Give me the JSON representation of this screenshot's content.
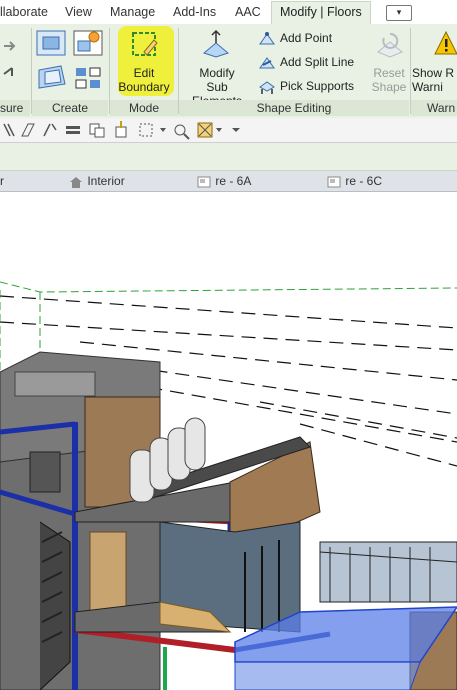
{
  "ribbon_tabs": [
    {
      "label": "llaborate"
    },
    {
      "label": "View"
    },
    {
      "label": "Manage"
    },
    {
      "label": "Add-Ins"
    },
    {
      "label": "AAC"
    },
    {
      "label": "Modify | Floors",
      "active": true
    }
  ],
  "panels": {
    "measure": {
      "title": "sure"
    },
    "create": {
      "title": "Create"
    },
    "mode": {
      "title": "Mode",
      "edit_boundary_label": "Edit\nBoundary"
    },
    "shape_editing": {
      "title": "Shape Editing",
      "modify_sub_elements_label": "Modify\nSub Elements",
      "add_point_label": "Add Point",
      "add_split_line_label": "Add Split Line",
      "pick_supports_label": "Pick Supports",
      "reset_shape_label": "Reset\nShape"
    },
    "warnings": {
      "title": "Warn",
      "show_warnings_label": "Show R\nWarni"
    }
  },
  "view_tabs": [
    {
      "label": "r"
    },
    {
      "label": "Interior",
      "icon": "home-icon"
    },
    {
      "label": "re - 6A",
      "icon": "plan-view-icon"
    },
    {
      "label": "re - 6C",
      "icon": "plan-view-icon"
    }
  ],
  "colors": {
    "ribbon_bg": "#e9f1e4",
    "highlight": "#f0f01e",
    "beam_blue": "#1a2fa8",
    "beam_red": "#b01f28",
    "selected_floor": "#5b7fe8"
  }
}
